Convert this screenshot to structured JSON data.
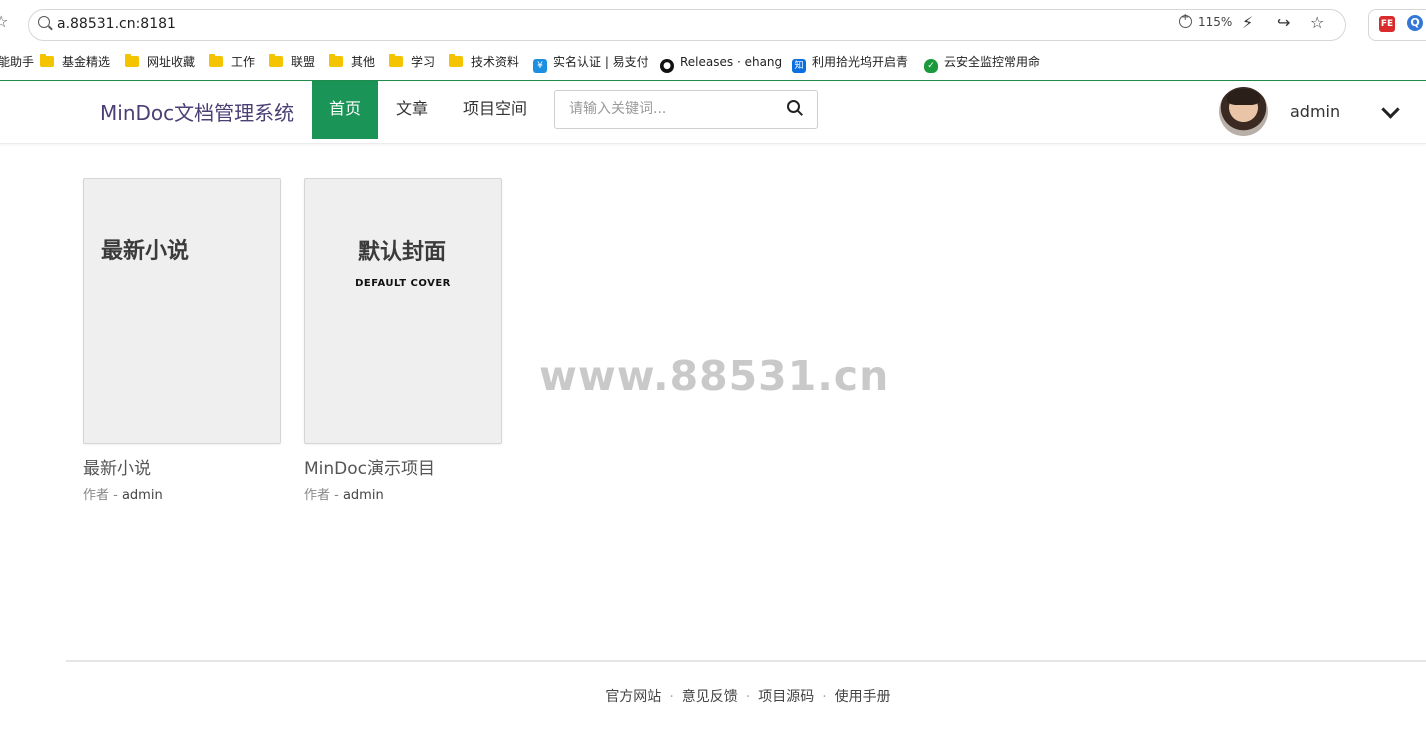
{
  "browser": {
    "url": "a.88531.cn:8181",
    "zoom": "115%",
    "bookmarks": [
      {
        "label": "能助手",
        "type": "text"
      },
      {
        "label": "基金精选",
        "type": "folder"
      },
      {
        "label": "网址收藏",
        "type": "folder"
      },
      {
        "label": "工作",
        "type": "folder"
      },
      {
        "label": "联盟",
        "type": "folder"
      },
      {
        "label": "其他",
        "type": "folder"
      },
      {
        "label": "学习",
        "type": "folder"
      },
      {
        "label": "技术资料",
        "type": "folder"
      },
      {
        "label": "实名认证 | 易支付",
        "type": "shield-icon"
      },
      {
        "label": "Releases · ehang",
        "type": "github-icon"
      },
      {
        "label": "利用拾光坞开启青",
        "type": "zhihu-icon"
      },
      {
        "label": "云安全监控常用命",
        "type": "shield-green-icon"
      }
    ]
  },
  "header": {
    "brand": "MinDoc文档管理系统",
    "nav": [
      "首页",
      "文章",
      "项目空间"
    ],
    "active_nav": "首页",
    "search_placeholder": "请输入关键词...",
    "user_name": "admin"
  },
  "projects": [
    {
      "cover_title": "最新小说",
      "cover_subtitle": "",
      "name": "最新小说",
      "author_label": "作者 - ",
      "author": "admin"
    },
    {
      "cover_title": "默认封面",
      "cover_subtitle": "DEFAULT COVER",
      "name": "MinDoc演示项目",
      "author_label": "作者 - ",
      "author": "admin"
    }
  ],
  "watermark": "www.88531.cn",
  "footer": {
    "links": [
      "官方网站",
      "意见反馈",
      "项目源码",
      "使用手册"
    ],
    "separator": "·"
  },
  "colors": {
    "accent": "#1a9457",
    "brand_text": "#4b3f74"
  }
}
